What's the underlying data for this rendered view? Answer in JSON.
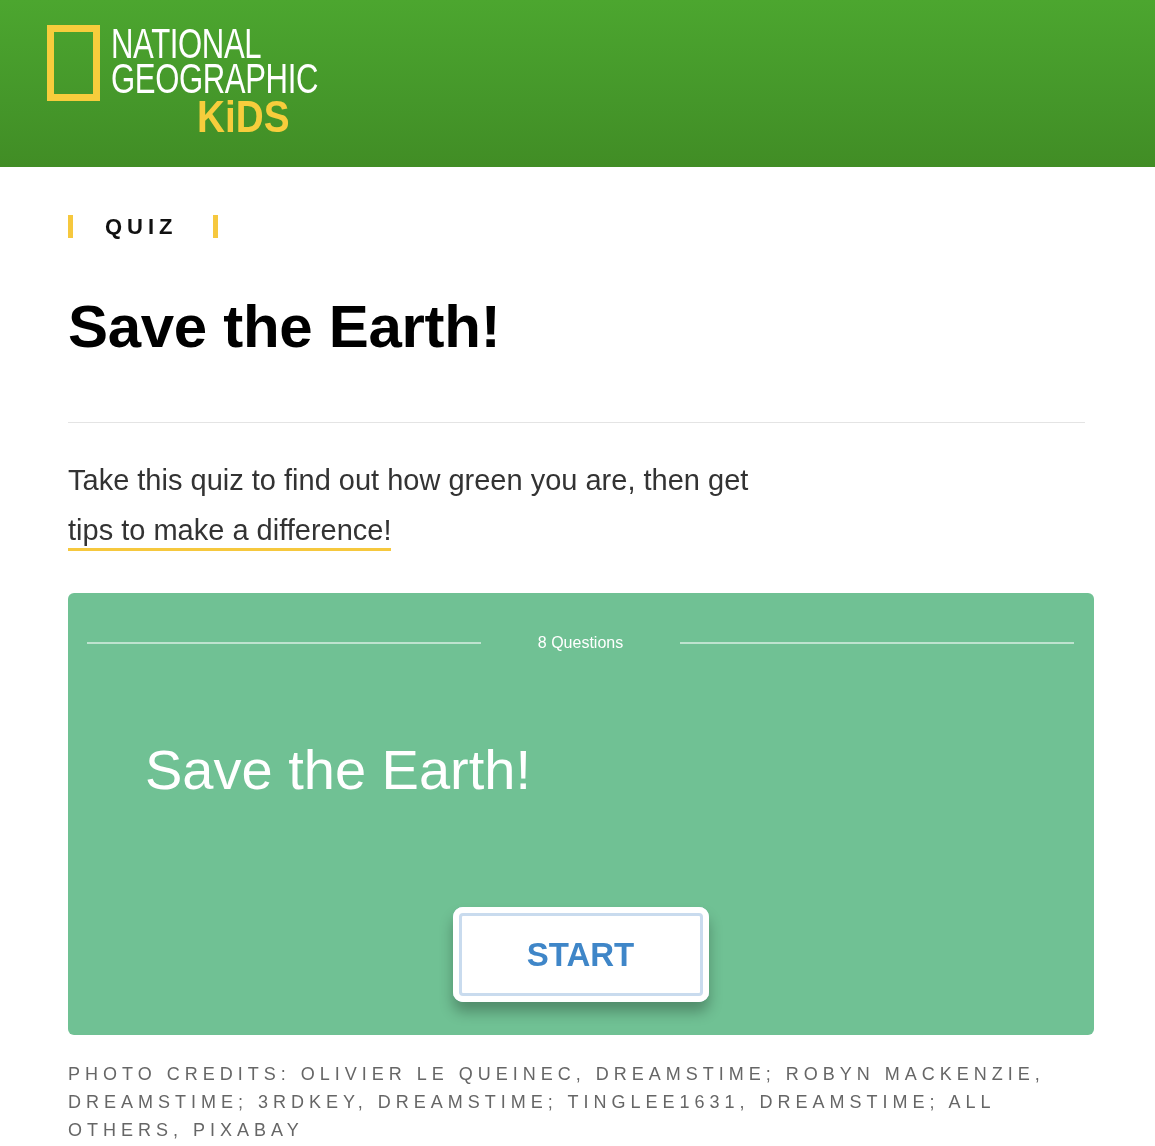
{
  "header": {
    "logo": {
      "line_1": "NATIONAL",
      "line_2": "GEOGRAPHIC",
      "line_3": "KiDS"
    }
  },
  "content_label": "QUIZ",
  "title": "Save the Earth!",
  "intro": {
    "text": "Take this quiz to find out how green you are, then get",
    "link": "tips to make a difference!"
  },
  "quiz_card": {
    "question_count": "8 Questions",
    "title": "Save the Earth!",
    "button": "START"
  },
  "photo_credits": "PHOTO CREDITS: OLIVIER LE QUEINEC, DREAMSTIME; ROBYN MACKENZIE, DREAMSTIME; 3RDKEY, DREAMSTIME; TINGLEE1631, DREAMSTIME; ALL OTHERS, PIXABAY"
}
